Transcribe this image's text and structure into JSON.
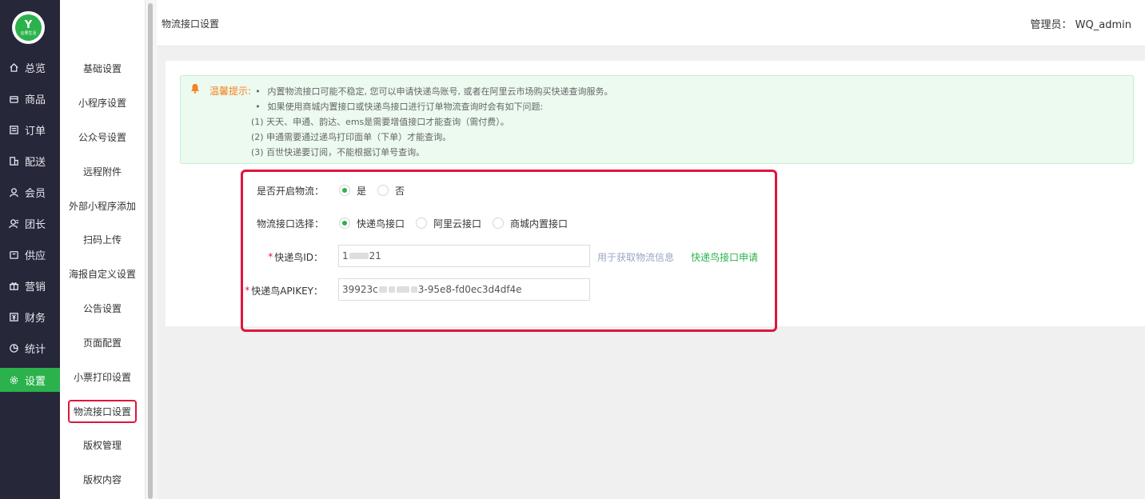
{
  "logo": {
    "mark": "Y",
    "text": "云果生活"
  },
  "nav": [
    {
      "label": "总览",
      "icon": "home-icon"
    },
    {
      "label": "商品",
      "icon": "goods-icon"
    },
    {
      "label": "订单",
      "icon": "order-icon"
    },
    {
      "label": "配送",
      "icon": "delivery-icon"
    },
    {
      "label": "会员",
      "icon": "member-icon"
    },
    {
      "label": "团长",
      "icon": "leader-icon"
    },
    {
      "label": "供应",
      "icon": "supply-icon"
    },
    {
      "label": "营销",
      "icon": "gift-icon"
    },
    {
      "label": "财务",
      "icon": "finance-icon"
    },
    {
      "label": "统计",
      "icon": "stats-icon"
    },
    {
      "label": "设置",
      "icon": "gear-icon",
      "active": true
    }
  ],
  "submenu": [
    {
      "label": "基础设置"
    },
    {
      "label": "小程序设置"
    },
    {
      "label": "公众号设置"
    },
    {
      "label": "远程附件"
    },
    {
      "label": "外部小程序添加"
    },
    {
      "label": "扫码上传"
    },
    {
      "label": "海报自定义设置"
    },
    {
      "label": "公告设置"
    },
    {
      "label": "页面配置"
    },
    {
      "label": "小票打印设置"
    },
    {
      "label": "物流接口设置",
      "active": true
    },
    {
      "label": "版权管理"
    },
    {
      "label": "版权内容"
    }
  ],
  "header": {
    "title": "物流接口设置",
    "admin": "管理员： WQ_admin"
  },
  "tip": {
    "label": "温馨提示:",
    "bullet": "•",
    "lines": [
      {
        "bullet": true,
        "text": "内置物流接口可能不稳定, 您可以申请快递鸟账号, 或者在阿里云市场购买快递查询服务。"
      },
      {
        "bullet": true,
        "text": "如果使用商城内置接口或快递鸟接口进行订单物流查询时会有如下问题:"
      },
      {
        "bullet": false,
        "text": "(1) 天天、申通、韵达、ems是需要增值接口才能查询（需付费）。"
      },
      {
        "bullet": false,
        "text": "(2) 申通需要通过递鸟打印面单（下单）才能查询。"
      },
      {
        "bullet": false,
        "text": "(3) 百世快递要订阅，不能根据订单号查询。"
      }
    ]
  },
  "form": {
    "enable_label": "是否开启物流：",
    "enable_options": [
      {
        "label": "是",
        "checked": true
      },
      {
        "label": "否",
        "checked": false
      }
    ],
    "api_label": "物流接口选择：",
    "api_options": [
      {
        "label": "快递鸟接口",
        "checked": true
      },
      {
        "label": "阿里云接口",
        "checked": false
      },
      {
        "label": "商城内置接口",
        "checked": false
      }
    ],
    "required_mark": "*",
    "id_label": "快递鸟ID：",
    "id_value_start": "1",
    "id_value_end": "21",
    "id_hint": "用于获取物流信息",
    "apply_link": "快递鸟接口申请",
    "key_label": "快递鸟APIKEY：",
    "key_value_start": "39923c",
    "key_value_end": "3-95e8-fd0ec3d4df4e"
  }
}
